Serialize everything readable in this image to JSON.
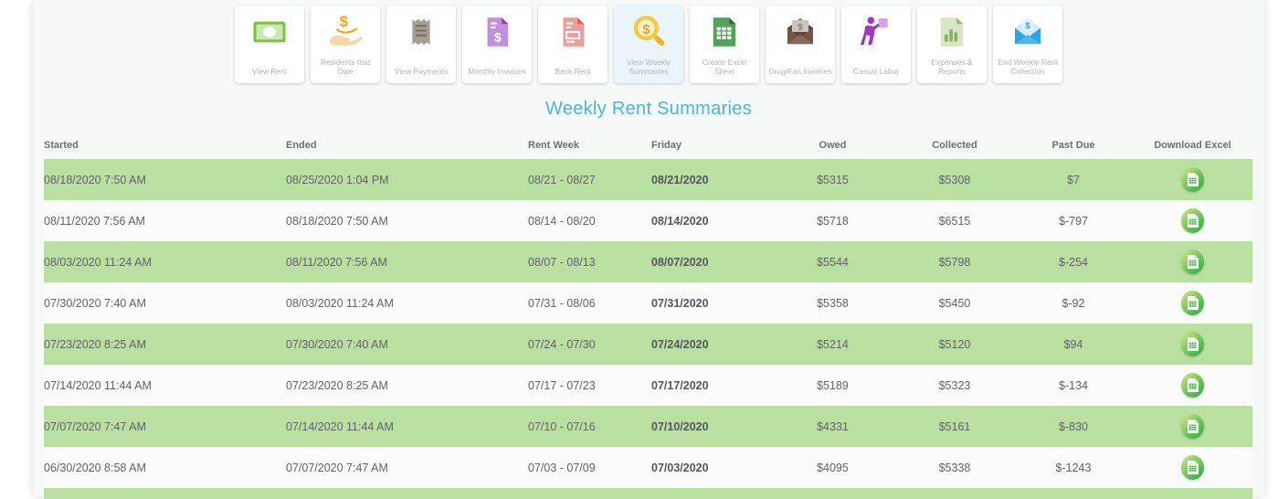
{
  "page": {
    "title": "Weekly Rent Summaries"
  },
  "colors": {
    "title_blue": "#45b7dd",
    "row_green": "#b9e0a0",
    "active_button_bg": "#e9f5fb",
    "download_button_green": "#3eb24a",
    "panel_bg": "#f7f8f8"
  },
  "toolbar": {
    "buttons": [
      {
        "label": "View Rent",
        "icon": "money-bill-icon",
        "active": false
      },
      {
        "label": "Residents that Owe",
        "icon": "hand-dollar-icon",
        "active": false
      },
      {
        "label": "View Payments",
        "icon": "receipt-icon",
        "active": false
      },
      {
        "label": "Monthly Invoices",
        "icon": "invoice-purple-icon",
        "active": false
      },
      {
        "label": "Back Rent",
        "icon": "invoice-red-icon",
        "active": false
      },
      {
        "label": "View Weekly Summaries",
        "icon": "search-dollar-icon",
        "active": true
      },
      {
        "label": "Create Excel Sheet",
        "icon": "excel-sheet-icon",
        "active": false
      },
      {
        "label": "Drug/Fan Invoices",
        "icon": "envelope-money-icon",
        "active": false
      },
      {
        "label": "Casual Labor",
        "icon": "worker-box-icon",
        "active": false
      },
      {
        "label": "Expenses & Reports",
        "icon": "report-chart-icon",
        "active": false
      },
      {
        "label": "End Weekly Rent Collection",
        "icon": "envelope-dollar-icon",
        "active": false
      }
    ]
  },
  "table": {
    "headers": [
      "Started",
      "Ended",
      "Rent Week",
      "Friday",
      "Owed",
      "Collected",
      "Past Due",
      "Download Excel"
    ],
    "row_keys": [
      "started",
      "ended",
      "rent_week",
      "friday",
      "owed",
      "collected",
      "past_due"
    ],
    "download_icon": "excel-file-icon",
    "rows": [
      {
        "started": "08/18/2020 7:50 AM",
        "ended": "08/25/2020 1:04 PM",
        "rent_week": "08/21 - 08/27",
        "friday": "08/21/2020",
        "owed": "$5315",
        "collected": "$5308",
        "past_due": "$7"
      },
      {
        "started": "08/11/2020 7:56 AM",
        "ended": "08/18/2020 7:50 AM",
        "rent_week": "08/14 - 08/20",
        "friday": "08/14/2020",
        "owed": "$5718",
        "collected": "$6515",
        "past_due": "$-797"
      },
      {
        "started": "08/03/2020 11:24 AM",
        "ended": "08/11/2020 7:56 AM",
        "rent_week": "08/07 - 08/13",
        "friday": "08/07/2020",
        "owed": "$5544",
        "collected": "$5798",
        "past_due": "$-254"
      },
      {
        "started": "07/30/2020 7:40 AM",
        "ended": "08/03/2020 11:24 AM",
        "rent_week": "07/31 - 08/06",
        "friday": "07/31/2020",
        "owed": "$5358",
        "collected": "$5450",
        "past_due": "$-92"
      },
      {
        "started": "07/23/2020 8:25 AM",
        "ended": "07/30/2020 7:40 AM",
        "rent_week": "07/24 - 07/30",
        "friday": "07/24/2020",
        "owed": "$5214",
        "collected": "$5120",
        "past_due": "$94"
      },
      {
        "started": "07/14/2020 11:44 AM",
        "ended": "07/23/2020 8:25 AM",
        "rent_week": "07/17 - 07/23",
        "friday": "07/17/2020",
        "owed": "$5189",
        "collected": "$5323",
        "past_due": "$-134"
      },
      {
        "started": "07/07/2020 7:47 AM",
        "ended": "07/14/2020 11:44 AM",
        "rent_week": "07/10 - 07/16",
        "friday": "07/10/2020",
        "owed": "$4331",
        "collected": "$5161",
        "past_due": "$-830"
      },
      {
        "started": "06/30/2020 8:58 AM",
        "ended": "07/07/2020 7:47 AM",
        "rent_week": "07/03 - 07/09",
        "friday": "07/03/2020",
        "owed": "$4095",
        "collected": "$5338",
        "past_due": "$-1243"
      }
    ]
  }
}
